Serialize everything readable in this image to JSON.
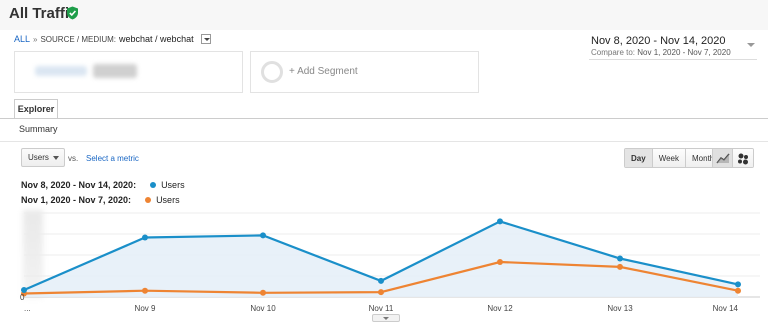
{
  "page": {
    "title": "All Traffic"
  },
  "breadcrumb": {
    "all": "ALL",
    "separator": "»",
    "dimension": "SOURCE / MEDIUM:",
    "value": "webchat / webchat"
  },
  "date_range": {
    "main": "Nov 8, 2020 - Nov 14, 2020",
    "compare_label": "Compare to:",
    "compare_value": "Nov 1, 2020 - Nov 7, 2020"
  },
  "segments": {
    "add_label": "+ Add Segment"
  },
  "tabs": {
    "explorer": "Explorer",
    "summary": "Summary"
  },
  "controls": {
    "metric": "Users",
    "vs": "vs.",
    "select_metric": "Select a metric",
    "periods": [
      "Day",
      "Week",
      "Month"
    ],
    "active_period": "Day"
  },
  "legend": {
    "current_range": "Nov 8, 2020 - Nov 14, 2020:",
    "previous_range": "Nov 1, 2020 - Nov 7, 2020:",
    "current_series": "Users",
    "previous_series": "Users"
  },
  "colors": {
    "current": "#1a8fc9",
    "previous": "#ee8433",
    "area": "#e6f0f8",
    "accent_link": "#1a67c4",
    "verified": "#1e9e4a"
  },
  "icons": [
    "verified-check-icon",
    "line-chart-icon",
    "motion-chart-icon"
  ],
  "chart_data": {
    "type": "line",
    "categories": [
      "...",
      "Nov 9",
      "Nov 10",
      "Nov 11",
      "Nov 12",
      "Nov 13",
      "Nov 14"
    ],
    "series": [
      {
        "name": "Users",
        "values": [
          1,
          8.5,
          8.8,
          2.3,
          10.8,
          5.5,
          1.8
        ]
      },
      {
        "name": "Users",
        "values": [
          0.5,
          0.9,
          0.6,
          0.7,
          5.0,
          4.3,
          0.9
        ]
      }
    ],
    "ylim": [
      0,
      12
    ],
    "y_tick_label": "0",
    "grid": true
  }
}
